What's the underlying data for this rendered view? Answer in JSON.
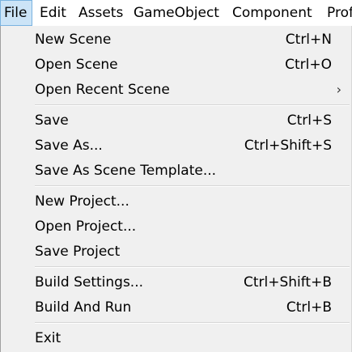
{
  "menubar": {
    "items": [
      "File",
      "Edit",
      "Assets",
      "GameObject",
      "Component",
      "Prof"
    ]
  },
  "file_menu": {
    "new_scene": {
      "label": "New Scene",
      "shortcut": "Ctrl+N"
    },
    "open_scene": {
      "label": "Open Scene",
      "shortcut": "Ctrl+O"
    },
    "open_recent_scene": {
      "label": "Open Recent Scene",
      "arrow": "›"
    },
    "save": {
      "label": "Save",
      "shortcut": "Ctrl+S"
    },
    "save_as": {
      "label": "Save As...",
      "shortcut": "Ctrl+Shift+S"
    },
    "save_as_scene_template": {
      "label": "Save As Scene Template..."
    },
    "new_project": {
      "label": "New Project..."
    },
    "open_project": {
      "label": "Open Project..."
    },
    "save_project": {
      "label": "Save Project"
    },
    "build_settings": {
      "label": "Build Settings...",
      "shortcut": "Ctrl+Shift+B"
    },
    "build_and_run": {
      "label": "Build And Run",
      "shortcut": "Ctrl+B"
    },
    "exit": {
      "label": "Exit"
    }
  },
  "colors": {
    "menu_background": "#f0f0f0",
    "menubar_background": "#ffffff",
    "active_highlight": "#cce4f7",
    "active_border": "#7ab3e0"
  }
}
